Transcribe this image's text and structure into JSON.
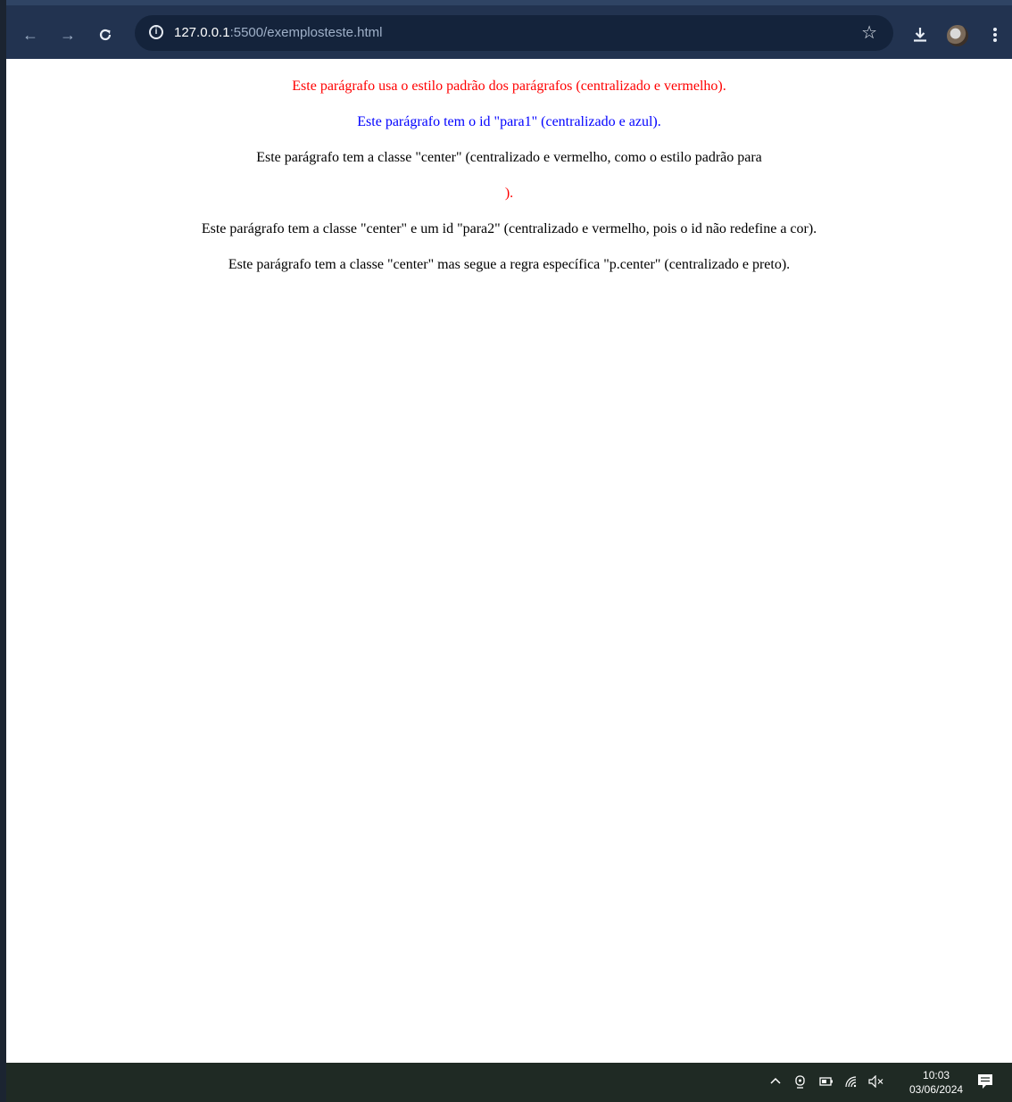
{
  "browser": {
    "url_host": "127.0.0.1",
    "url_path": ":5500/exemplosteste.html",
    "icons": [
      "back-arrow-icon",
      "forward-arrow-icon",
      "reload-icon",
      "site-info-icon",
      "bookmark-star-icon",
      "download-icon",
      "profile-avatar",
      "more-menu-icon"
    ]
  },
  "page": {
    "paragraphs": [
      {
        "text": "Este parágrafo usa o estilo padrão dos parágrafos (centralizado e vermelho).",
        "color": "#ff0000"
      },
      {
        "text": "Este parágrafo tem o id \"para1\" (centralizado e azul).",
        "color": "#0000ff"
      },
      {
        "text": "Este parágrafo tem a classe \"center\" (centralizado e vermelho, como o estilo padrão para",
        "color": "#000000"
      },
      {
        "text": ").",
        "color": "#ff0000"
      },
      {
        "text": "Este parágrafo tem a classe \"center\" e um id \"para2\" (centralizado e vermelho, pois o id não redefine a cor).",
        "color": "#000000"
      },
      {
        "text": "Este parágrafo tem a classe \"center\" mas segue a regra específica \"p.center\" (centralizado e preto).",
        "color": "#000000"
      }
    ]
  },
  "taskbar": {
    "time": "10:03",
    "date": "03/06/2024",
    "tray_icons": [
      "chevron-up-icon",
      "camera-icon",
      "battery-icon",
      "wifi-icon",
      "volume-muted-icon",
      "notifications-icon"
    ]
  }
}
